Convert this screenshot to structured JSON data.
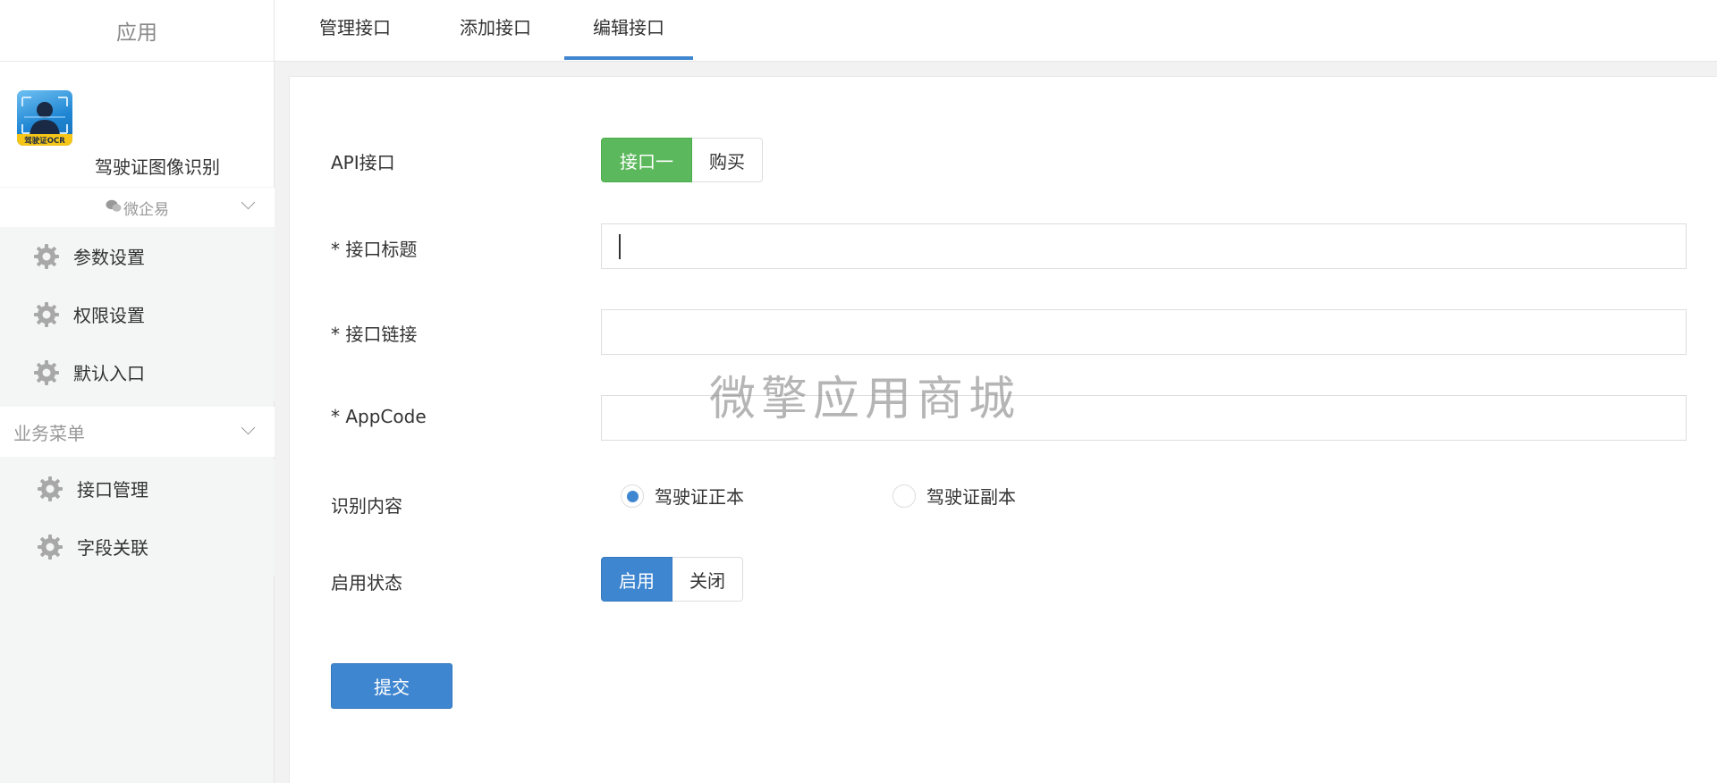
{
  "sidebar": {
    "title": "应用",
    "app_name": "驾驶证图像识别",
    "app_logo_text": "驾驶证OCR",
    "wq_label": "微企易",
    "settings_items": [
      {
        "label": "参数设置"
      },
      {
        "label": "权限设置"
      },
      {
        "label": "默认入口"
      }
    ],
    "business_menu": {
      "label": "业务菜单",
      "items": [
        {
          "label": "接口管理"
        },
        {
          "label": "字段关联"
        }
      ]
    }
  },
  "tabs": [
    {
      "label": "管理接口"
    },
    {
      "label": "添加接口"
    },
    {
      "label": "编辑接口",
      "active": true
    }
  ],
  "form": {
    "api": {
      "label": "API接口",
      "option_selected": "接口一",
      "option_other": "购买"
    },
    "title": {
      "label": "* 接口标题",
      "value": ""
    },
    "link": {
      "label": "* 接口链接",
      "value": ""
    },
    "appcode": {
      "label": "* AppCode",
      "value": ""
    },
    "recognize": {
      "label": "识别内容",
      "options": [
        {
          "label": "驾驶证正本",
          "checked": true
        },
        {
          "label": "驾驶证副本",
          "checked": false
        }
      ]
    },
    "status": {
      "label": "启用状态",
      "option_on": "启用",
      "option_off": "关闭"
    },
    "submit_label": "提交"
  },
  "watermark": "微擎应用商城",
  "colors": {
    "accent_blue": "#3f86d0",
    "accent_green": "#5cb85c"
  }
}
